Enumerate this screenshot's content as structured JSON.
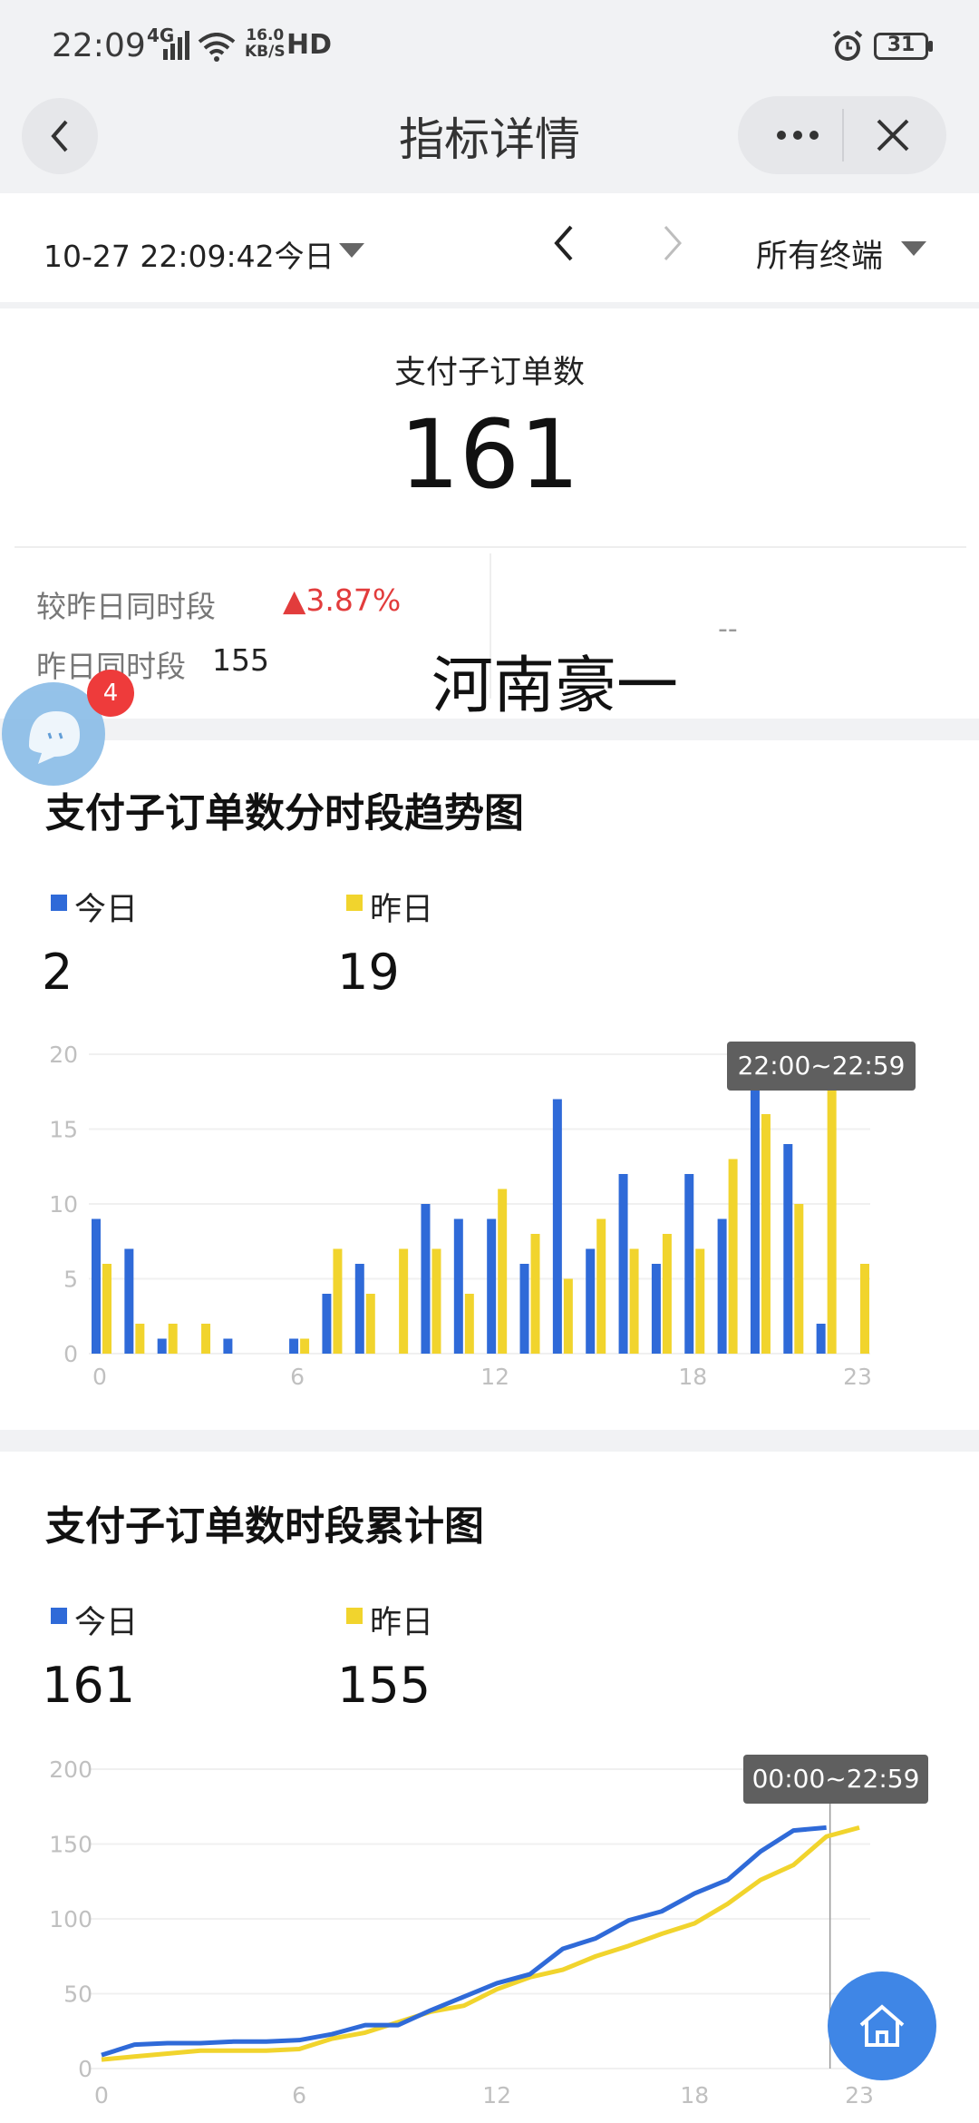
{
  "status_bar": {
    "time": "22:09",
    "network": "4G",
    "speed_top": "16.0",
    "speed_unit": "KB/S",
    "hd": "HD",
    "battery": "31"
  },
  "nav": {
    "title": "指标详情",
    "back_icon": "chevron-left-icon",
    "more_icon": "more-icon",
    "close_icon": "close-icon"
  },
  "filter": {
    "date": "10-27 22:09:42今日",
    "terminal": "所有终端"
  },
  "metric": {
    "label": "支付子订单数",
    "value": "161",
    "compare_label": "较昨日同时段",
    "compare_value": "▲3.87%",
    "yesterday_label": "昨日同时段",
    "yesterday_value": "155",
    "dash": "--"
  },
  "watermark": "河南豪一",
  "floating_badge": "4",
  "colors": {
    "today": "#2f6ad8",
    "yesterday": "#f1d42d",
    "accent_red": "#e23c3c"
  },
  "trend": {
    "title": "支付子订单数分时段趋势图",
    "legend_today": "今日",
    "legend_yesterday": "昨日",
    "today_value": "2",
    "yesterday_value": "19",
    "tooltip": "22:00~22:59"
  },
  "cumulative": {
    "title": "支付子订单数时段累计图",
    "legend_today": "今日",
    "legend_yesterday": "昨日",
    "today_value": "161",
    "yesterday_value": "155",
    "tooltip": "00:00~22:59"
  },
  "chart_data": [
    {
      "type": "bar",
      "categories": [
        "0",
        "1",
        "2",
        "3",
        "4",
        "5",
        "6",
        "7",
        "8",
        "9",
        "10",
        "11",
        "12",
        "13",
        "14",
        "15",
        "16",
        "17",
        "18",
        "19",
        "20",
        "21",
        "22",
        "23"
      ],
      "x_tick_labels": [
        "0",
        "6",
        "12",
        "18",
        "23"
      ],
      "y_tick_labels": [
        "0",
        "5",
        "10",
        "15",
        "20"
      ],
      "ylim": [
        0,
        20
      ],
      "series": [
        {
          "name": "今日",
          "values": [
            9,
            7,
            1,
            0,
            1,
            0,
            1,
            4,
            6,
            0,
            10,
            9,
            9,
            6,
            17,
            7,
            12,
            6,
            12,
            9,
            19,
            14,
            2,
            null
          ]
        },
        {
          "name": "昨日",
          "values": [
            6,
            2,
            2,
            2,
            0,
            0,
            1,
            7,
            4,
            7,
            7,
            4,
            11,
            8,
            5,
            9,
            7,
            8,
            7,
            13,
            16,
            10,
            19,
            6
          ]
        }
      ]
    },
    {
      "type": "line",
      "x": [
        0,
        1,
        2,
        3,
        4,
        5,
        6,
        7,
        8,
        9,
        10,
        11,
        12,
        13,
        14,
        15,
        16,
        17,
        18,
        19,
        20,
        21,
        22,
        23
      ],
      "x_tick_labels": [
        "0",
        "6",
        "12",
        "18",
        "23"
      ],
      "y_tick_labels": [
        "0",
        "50",
        "100",
        "150",
        "200"
      ],
      "ylim": [
        0,
        200
      ],
      "series": [
        {
          "name": "今日",
          "values": [
            9,
            16,
            17,
            17,
            18,
            18,
            19,
            23,
            29,
            29,
            39,
            48,
            57,
            63,
            80,
            87,
            99,
            105,
            117,
            126,
            145,
            159,
            161,
            null
          ]
        },
        {
          "name": "昨日",
          "values": [
            6,
            8,
            10,
            12,
            12,
            12,
            13,
            20,
            24,
            31,
            38,
            42,
            53,
            61,
            66,
            75,
            82,
            90,
            97,
            110,
            126,
            136,
            155,
            161
          ]
        }
      ]
    }
  ]
}
